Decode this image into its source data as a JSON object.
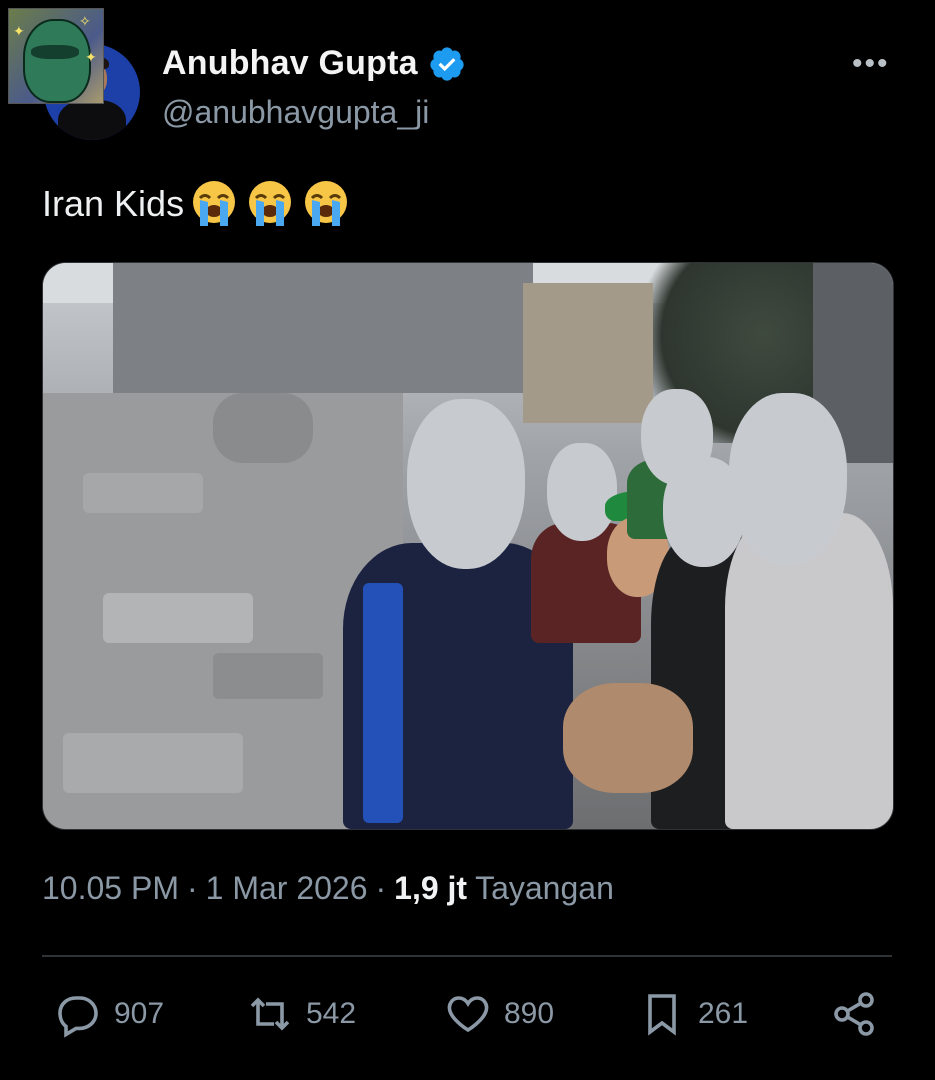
{
  "author": {
    "display_name": "Anubhav Gupta",
    "handle": "@anubhavgupta_ji",
    "verified": true,
    "verified_color": "#1d9bf0"
  },
  "post": {
    "text": "Iran Kids",
    "emoji": [
      "loudly-crying-face",
      "loudly-crying-face",
      "loudly-crying-face"
    ]
  },
  "meta": {
    "time": "10.05 PM",
    "date": "1 Mar 2026",
    "views_count": "1,9 jt",
    "views_label": "Tayangan",
    "separator": "·"
  },
  "actions": {
    "reply_count": "907",
    "repost_count": "542",
    "like_count": "890",
    "bookmark_count": "261"
  },
  "menu_icon": "more-horizontal-icon"
}
